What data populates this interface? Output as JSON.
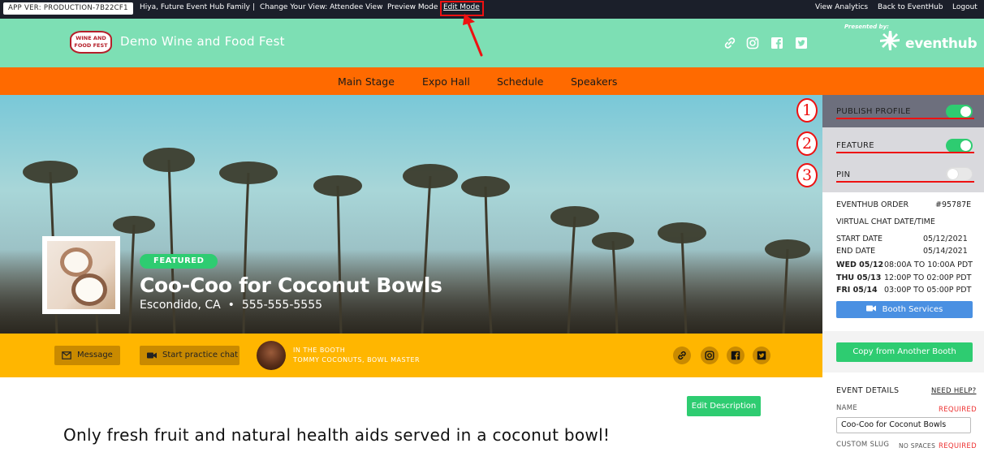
{
  "topbar": {
    "app_version": "APP VER: PRODUCTION-7B22CF1",
    "greeting": "Hiya, Future Event Hub Family",
    "separator": "|",
    "change_view": "Change Your View: Attendee View",
    "preview_mode": "Preview Mode",
    "edit_mode": "Edit Mode",
    "view_analytics": "View Analytics",
    "back_to_eventhub": "Back to EventHub",
    "logout": "Logout"
  },
  "header": {
    "logo_text": [
      "WINE AND",
      "FOOD FEST"
    ],
    "title": "Demo Wine and Food Fest",
    "social_icons": [
      "link-icon",
      "instagram-icon",
      "facebook-icon",
      "twitter-icon"
    ],
    "presented_by": "Presented by:",
    "brand": "eventhub",
    "bg_color": "#7ddfb4"
  },
  "nav": {
    "items": [
      "Main Stage",
      "Expo Hall",
      "Schedule",
      "Speakers"
    ],
    "bg_color": "#ff6a00"
  },
  "hero": {
    "badge": "FEATURED",
    "title": "Coo-Coo for Coconut Bowls",
    "location": "Escondido, CA",
    "bullet": "•",
    "phone": "555-555-5555"
  },
  "booth_bar": {
    "message_label": "Message",
    "practice_chat_label": "Start practice chat",
    "in_booth_label": "IN THE BOOTH",
    "in_booth_name": "TOMMY COCONUTS, BOWL MASTER",
    "social_icons": [
      "link-icon",
      "instagram-icon",
      "facebook-icon",
      "twitter-icon"
    ],
    "bg_color": "#ffb600"
  },
  "content": {
    "edit_description_label": "Edit Description",
    "description": "Only fresh fruit and natural health aids served in a coconut bowl!"
  },
  "sidebar": {
    "toggles": [
      {
        "label": "PUBLISH PROFILE",
        "on": true,
        "marker": "1"
      },
      {
        "label": "FEATURE",
        "on": true,
        "marker": "2"
      },
      {
        "label": "PIN",
        "on": false,
        "marker": "3"
      }
    ],
    "order_label": "EVENTHUB ORDER",
    "order_number": "#95787E",
    "virtual_chat_label": "VIRTUAL CHAT DATE/TIME",
    "start_date_label": "START DATE",
    "start_date": "05/12/2021",
    "end_date_label": "END DATE",
    "end_date": "05/14/2021",
    "schedule": [
      {
        "day": "WED 05/12",
        "time": "08:00A TO 10:00A PDT"
      },
      {
        "day": "THU 05/13",
        "time": "12:00P TO 02:00P PDT"
      },
      {
        "day": "FRI 05/14",
        "time": "03:00P TO 05:00P PDT"
      }
    ],
    "booth_services_label": "Booth Services",
    "copy_booth_label": "Copy from Another Booth",
    "event_details_label": "EVENT DETAILS",
    "need_help_label": "NEED HELP?",
    "name_label": "NAME",
    "required_label": "REQUIRED",
    "name_value": "Coo-Coo for Coconut Bowls",
    "custom_slug_label": "CUSTOM SLUG",
    "no_spaces_label": "NO SPACES",
    "required_label_2": "REQUIRED"
  }
}
